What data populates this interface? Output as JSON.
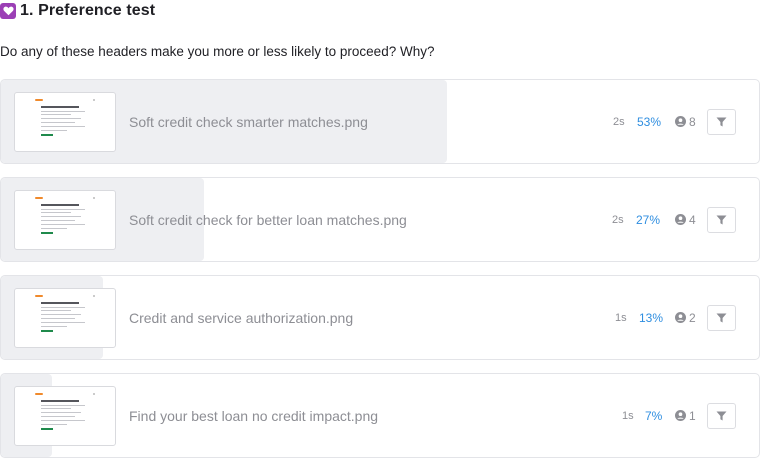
{
  "header": {
    "title": "1. Preference test",
    "icon": "heart-icon",
    "icon_color": "#9b3fb5"
  },
  "question": "Do any of these headers make you more or less likely to proceed? Why?",
  "accent_color": "#2f8ee0",
  "options": [
    {
      "file_name": "Soft credit check smarter matches.png",
      "time": "2s",
      "percent": "53%",
      "share": 0.53,
      "participants": "8"
    },
    {
      "file_name": "Soft credit check for better loan matches.png",
      "time": "2s",
      "percent": "27%",
      "share": 0.27,
      "participants": "4"
    },
    {
      "file_name": "Credit and service authorization.png",
      "time": "1s",
      "percent": "13%",
      "share": 0.13,
      "participants": "2"
    },
    {
      "file_name": "Find your best loan no credit impact.png",
      "time": "1s",
      "percent": "7%",
      "share": 0.07,
      "participants": "1"
    }
  ]
}
